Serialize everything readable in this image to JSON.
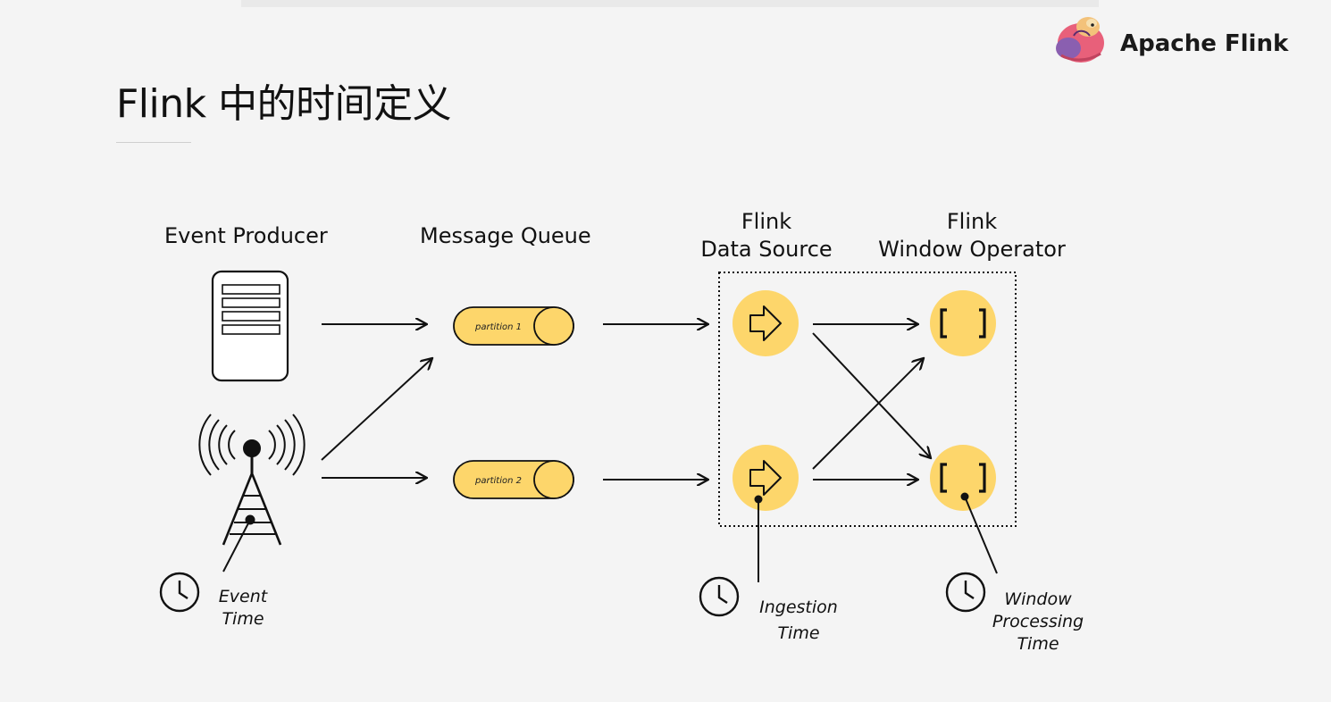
{
  "slide": {
    "title": "Flink 中的时间定义"
  },
  "logo": {
    "text": "Apache Flink",
    "icon": "squirrel-logo-icon"
  },
  "diagram": {
    "columns": {
      "producer": "Event Producer",
      "queue": "Message Queue",
      "source_line1": "Flink",
      "source_line2": "Data Source",
      "window_line1": "Flink",
      "window_line2": "Window Operator"
    },
    "partitions": [
      "partition 1",
      "partition 2"
    ],
    "times": {
      "event_line1": "Event",
      "event_line2": "Time",
      "ingestion_line1": "Ingestion",
      "ingestion_line2": "Time",
      "window_line1": "Window",
      "window_line2": "Processing",
      "window_line3": "Time"
    },
    "icons": [
      "server-icon",
      "antenna-tower-icon",
      "clock-icon",
      "arrow-right-icon",
      "brackets-icon"
    ],
    "colors": {
      "accent": "#fdd66b",
      "stroke": "#111111"
    }
  }
}
